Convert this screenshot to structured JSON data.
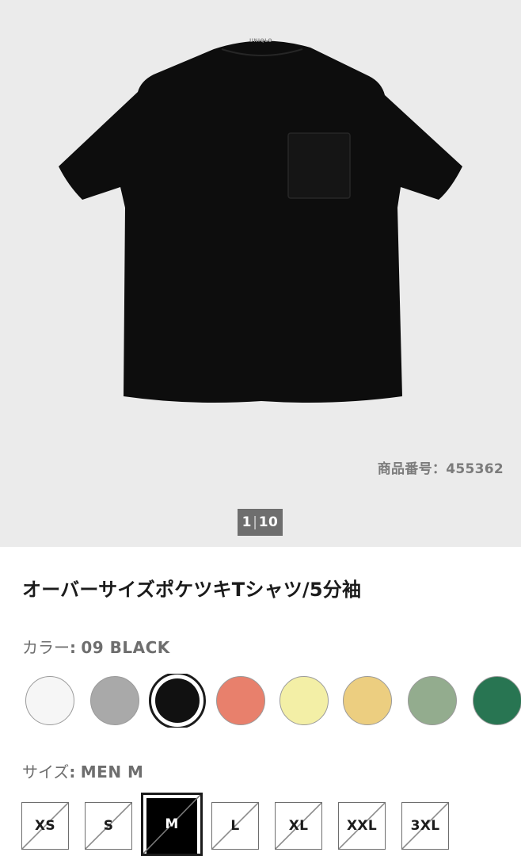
{
  "gallery": {
    "brand": "UNIQLO",
    "product_id_label": "商品番号",
    "product_id_sep": "：",
    "product_id": "455362",
    "counter_current": "1",
    "counter_total": "10"
  },
  "product": {
    "title": "オーバーサイズポケツキTシャツ/5分袖"
  },
  "color": {
    "label": "カラー",
    "sep": ":",
    "value": "09 BLACK",
    "swatches": [
      {
        "name": "white",
        "hex": "#f6f6f6"
      },
      {
        "name": "gray",
        "hex": "#a9a9a9"
      },
      {
        "name": "black",
        "hex": "#111111",
        "selected": true
      },
      {
        "name": "orange",
        "hex": "#e8806c"
      },
      {
        "name": "light-yellow",
        "hex": "#f3efa6"
      },
      {
        "name": "yellow",
        "hex": "#ecce80"
      },
      {
        "name": "green",
        "hex": "#93ac8e"
      },
      {
        "name": "dark-green",
        "hex": "#287552"
      }
    ]
  },
  "size": {
    "label": "サイズ",
    "sep": ":",
    "value": "MEN M",
    "options": [
      {
        "label": "XS",
        "available": false
      },
      {
        "label": "S",
        "available": false
      },
      {
        "label": "M",
        "available": false,
        "selected": true
      },
      {
        "label": "L",
        "available": false
      },
      {
        "label": "XL",
        "available": false
      },
      {
        "label": "XXL",
        "available": false
      },
      {
        "label": "3XL",
        "available": false
      }
    ]
  }
}
